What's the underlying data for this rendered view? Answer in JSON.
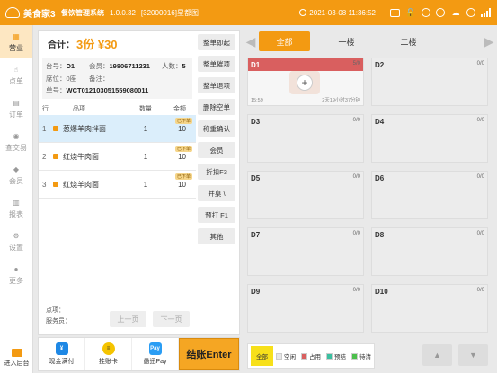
{
  "titlebar": {
    "app_name": "美食家3",
    "system_name": "餐饮管理系统",
    "version": "1.0.0.32",
    "store": "[32000016]星都图",
    "datetime": "2021-03-08 11:36:52"
  },
  "nav": {
    "items": [
      {
        "label": "营业",
        "icon": "store-icon"
      },
      {
        "label": "点单",
        "icon": "hand-pointer-icon"
      },
      {
        "label": "订单",
        "icon": "document-icon"
      },
      {
        "label": "查交易",
        "icon": "coins-icon"
      },
      {
        "label": "会员",
        "icon": "diamond-icon"
      },
      {
        "label": "报表",
        "icon": "chart-icon"
      },
      {
        "label": "设置",
        "icon": "gear-icon"
      },
      {
        "label": "更多",
        "icon": "more-icon"
      }
    ],
    "backend_label": "进入后台"
  },
  "order": {
    "total_label": "合计：",
    "total_amount": "3份 ¥30",
    "table_label": "台号：",
    "table_no": "D1",
    "member_label": "会员：",
    "member_phone": "19806711231",
    "people_label": "人数：",
    "people": "5",
    "seat_label": "席位：",
    "seat": "0座",
    "note_label": "备注：",
    "note": "",
    "bill_label": "单号：",
    "bill_no": "WCT012103051559080011",
    "columns": [
      "行",
      "品项",
      "数量",
      "金额"
    ],
    "items": [
      {
        "no": "1",
        "name": "葱爆羊肉拌面",
        "qty": "1",
        "amount": "10",
        "tag": "已下单"
      },
      {
        "no": "2",
        "name": "红烧牛肉面",
        "qty": "1",
        "amount": "10",
        "tag": "已下单"
      },
      {
        "no": "3",
        "name": "红烧羊肉面",
        "qty": "1",
        "amount": "10",
        "tag": "已下单"
      }
    ],
    "orderer_label": "点项：",
    "waiter_label": "服务员：",
    "prev_page": "上一页",
    "next_page": "下一页",
    "actions": [
      "整单即起",
      "整单催项",
      "整单退项",
      "删除空单",
      "称重确认",
      "会员",
      "折扣F3",
      "并桌 \\",
      "预打 F1",
      "其他"
    ]
  },
  "paybar": {
    "methods": [
      {
        "label": "现金满付",
        "icon": "cash-icon",
        "glyph": "¥"
      },
      {
        "label": "挂账卡",
        "icon": "card-icon",
        "glyph": "≡"
      },
      {
        "label": "愚迅Pay",
        "icon": "pay-icon",
        "glyph": "Pay"
      }
    ],
    "settle_label": "结账Enter"
  },
  "tables": {
    "tabs": [
      "全部",
      "一楼",
      "二楼"
    ],
    "active_tab": 0,
    "list": [
      {
        "name": "D1",
        "cap": "5/0",
        "used": true,
        "time": "15:59",
        "duration": "2天19小时37分钟"
      },
      {
        "name": "D2",
        "cap": "0/0",
        "used": false
      },
      {
        "name": "D3",
        "cap": "0/0",
        "used": false
      },
      {
        "name": "D4",
        "cap": "0/0",
        "used": false
      },
      {
        "name": "D5",
        "cap": "0/0",
        "used": false
      },
      {
        "name": "D6",
        "cap": "0/0",
        "used": false
      },
      {
        "name": "D7",
        "cap": "0/0",
        "used": false
      },
      {
        "name": "D8",
        "cap": "0/0",
        "used": false
      },
      {
        "name": "D9",
        "cap": "0/0",
        "used": false
      },
      {
        "name": "D10",
        "cap": "0/0",
        "used": false
      }
    ],
    "legend": [
      {
        "label": "全部",
        "color": "#f7e01a"
      },
      {
        "label": "空闲",
        "color": "#e6e6e6"
      },
      {
        "label": "占用",
        "color": "#d95f5f"
      },
      {
        "label": "预结",
        "color": "#3bbfa0"
      },
      {
        "label": "待清",
        "color": "#4cbf4c"
      }
    ]
  },
  "colors": {
    "accent": "#f39a12",
    "occupied": "#d95f5f",
    "selected_row": "#dbeefb"
  }
}
